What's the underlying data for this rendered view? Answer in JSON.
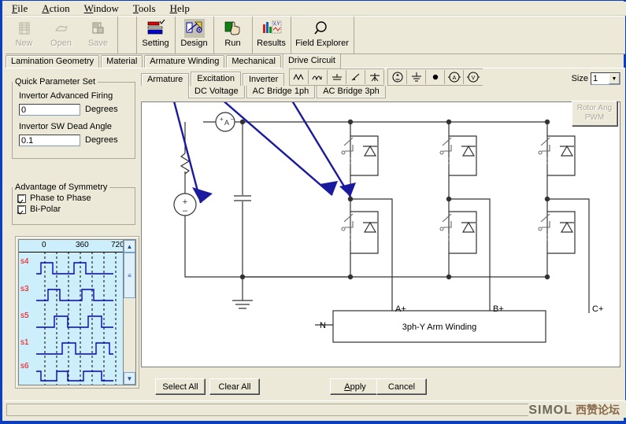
{
  "menu": {
    "items": [
      {
        "label": "File",
        "accel": "F"
      },
      {
        "label": "Action",
        "accel": "A"
      },
      {
        "label": "Window",
        "accel": "W"
      },
      {
        "label": "Tools",
        "accel": "T"
      },
      {
        "label": "Help",
        "accel": "H"
      }
    ]
  },
  "toolbar": {
    "buttons": [
      {
        "label": "New",
        "icon": "new-document-icon",
        "enabled": false
      },
      {
        "label": "Open",
        "icon": "open-folder-icon",
        "enabled": false
      },
      {
        "label": "Save",
        "icon": "save-disk-icon",
        "enabled": false
      },
      {
        "label": "Setting",
        "icon": "setting-bars-icon",
        "enabled": true
      },
      {
        "label": "Design",
        "icon": "design-compass-icon",
        "enabled": true
      },
      {
        "label": "Run",
        "icon": "run-hand-icon",
        "enabled": true
      },
      {
        "label": "Results",
        "icon": "results-chart-icon",
        "enabled": true
      },
      {
        "label": "Field Explorer",
        "icon": "magnifier-icon",
        "enabled": true
      }
    ]
  },
  "tabs": {
    "items": [
      {
        "label": "Lamination Geometry",
        "active": false
      },
      {
        "label": "Material",
        "active": false
      },
      {
        "label": "Armature Winding",
        "active": false
      },
      {
        "label": "Mechanical",
        "active": false
      },
      {
        "label": "Drive Circuit",
        "active": true
      }
    ]
  },
  "left_panel": {
    "quick_parameter_set": {
      "legend": "Quick Parameter Set",
      "fields": [
        {
          "label": "Invertor Advanced Firing",
          "value": "0",
          "unit": "Degrees"
        },
        {
          "label": "Invertor SW Dead Angle",
          "value": "0.1",
          "unit": "Degrees"
        }
      ]
    },
    "advantage_of_symmetry": {
      "legend": "Advantage of Symmetry",
      "checkboxes": [
        {
          "label": "Phase to Phase",
          "checked": true
        },
        {
          "label": "Bi-Polar",
          "checked": true
        }
      ]
    }
  },
  "waveform": {
    "axis_ticks": [
      "0",
      "360",
      "720"
    ],
    "signals": [
      "s4",
      "s3",
      "s5",
      "s1",
      "s6"
    ],
    "scrollbar": {
      "up": "▲",
      "down": "▼",
      "thumb": "≡"
    },
    "colors": {
      "background": "#cdeffb",
      "trace": "#0000cd",
      "label": "#ff0000"
    }
  },
  "editor": {
    "sub_tabs": [
      {
        "label": "Armature",
        "active": false
      },
      {
        "label": "Excitation",
        "active": true
      },
      {
        "label": "Inverter",
        "active": false
      }
    ],
    "sub_tabs2": [
      {
        "label": "DC Voltage",
        "active": true
      },
      {
        "label": "AC Bridge 1ph",
        "active": false
      },
      {
        "label": "AC Bridge 3ph",
        "active": false
      }
    ],
    "palette": [
      {
        "name": "resistor-icon",
        "glyph": "∨∨"
      },
      {
        "name": "inductor-icon",
        "glyph": "∩∩"
      },
      {
        "name": "capacitor-icon",
        "glyph": "⊥"
      },
      {
        "name": "diode-icon",
        "glyph": "⁄"
      },
      {
        "name": "transformer-icon",
        "glyph": "大"
      },
      {
        "name": "source-icon",
        "glyph": "⊕"
      },
      {
        "name": "ground-icon",
        "glyph": "⏚"
      },
      {
        "name": "node-dot-icon",
        "glyph": "●"
      },
      {
        "name": "ammeter-icon",
        "glyph": "A"
      },
      {
        "name": "voltmeter-icon",
        "glyph": "V"
      }
    ],
    "size": {
      "label": "Size",
      "value": "1",
      "arrow": "▼"
    },
    "rotor_button": {
      "line1": "Rotor Ang",
      "line2": "PWM",
      "enabled": false
    }
  },
  "circuit": {
    "winding_block_label": "3ph-Y Arm Winding",
    "terminals": [
      "A+",
      "B+",
      "C+"
    ],
    "neutral_label": "N",
    "source_plus": "+",
    "source_minus": "−",
    "ammeter_plus": "+",
    "ammeter_letter": "A",
    "ammeter_minus": "−",
    "annotation_color": "#1a1a9e"
  },
  "footer": {
    "buttons": [
      {
        "label": "Select All",
        "name": "select-all-button"
      },
      {
        "label": "Clear All",
        "name": "clear-all-button"
      },
      {
        "label": "Apply",
        "name": "apply-button",
        "accel": "A"
      },
      {
        "label": "Cancel",
        "name": "cancel-button"
      }
    ]
  },
  "statusbar": {
    "watermark_latin": "SIMOL",
    "watermark_cjk": "西赞论坛"
  }
}
